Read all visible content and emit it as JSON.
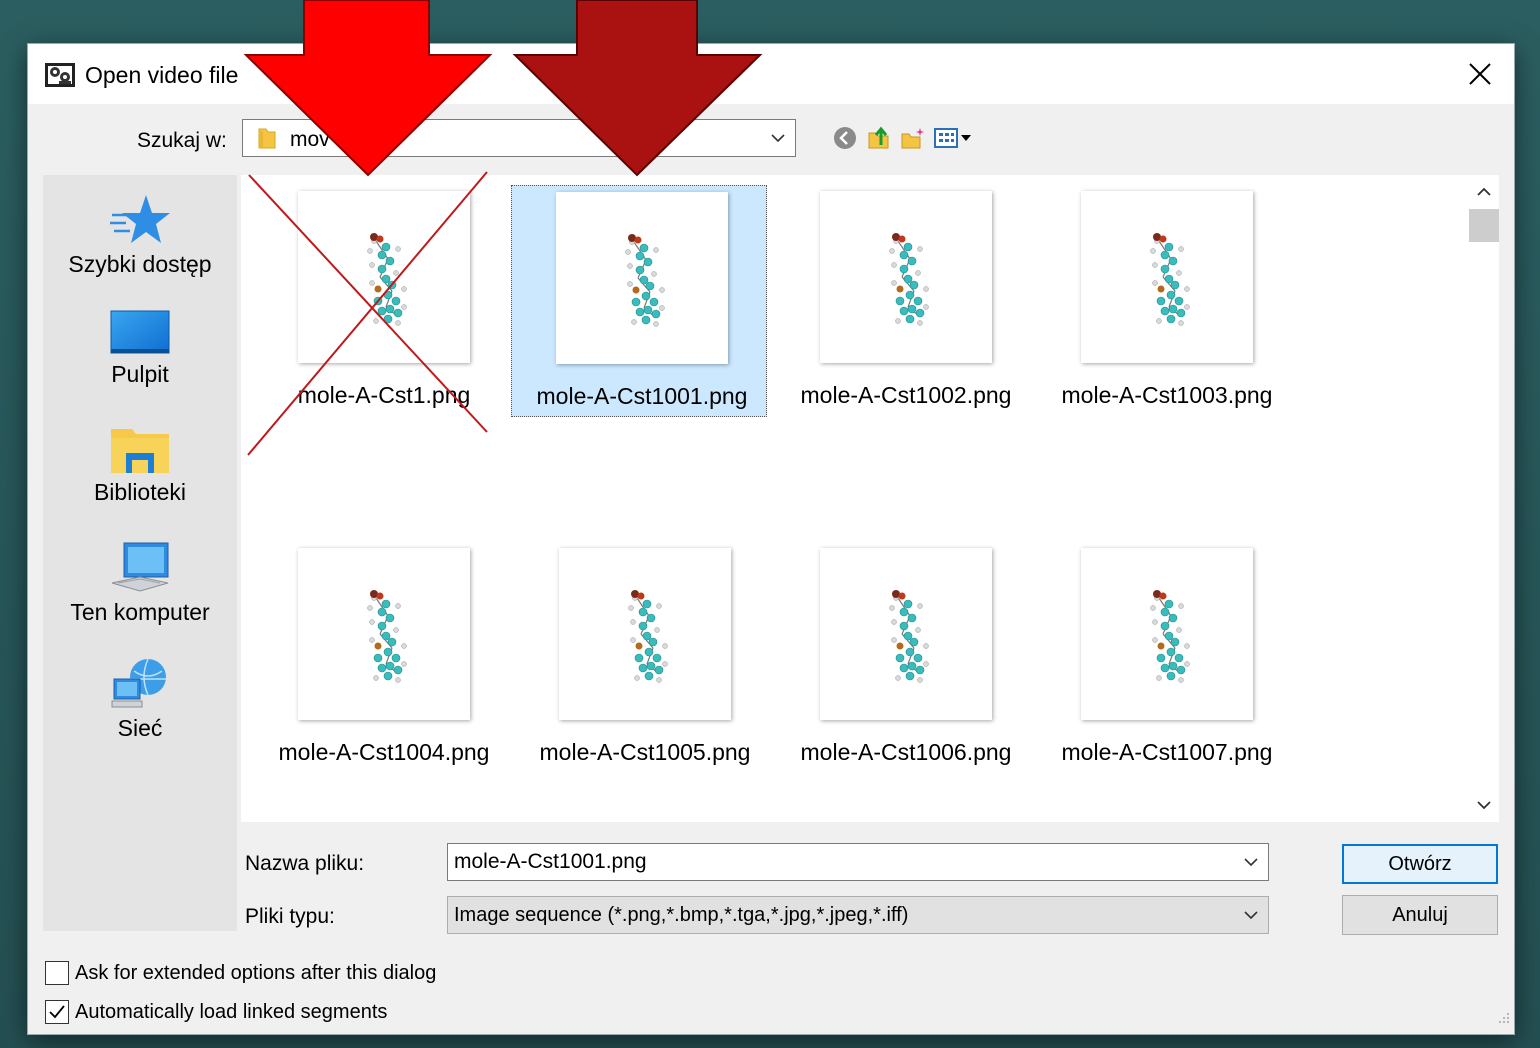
{
  "dialog": {
    "title": "Open video file",
    "look_in": {
      "label": "Szukaj w:",
      "value": "mov"
    },
    "places": [
      {
        "label": "Szybki dostęp",
        "icon": "star-icon"
      },
      {
        "label": "Pulpit",
        "icon": "desktop-icon"
      },
      {
        "label": "Biblioteki",
        "icon": "libraries-icon"
      },
      {
        "label": "Ten komputer",
        "icon": "computer-icon"
      },
      {
        "label": "Sieć",
        "icon": "network-icon"
      }
    ],
    "files": [
      {
        "name": "mole-A-Cst1.png",
        "selected": false,
        "crossed_out": true
      },
      {
        "name": "mole-A-Cst1001.png",
        "selected": true,
        "crossed_out": false
      },
      {
        "name": "mole-A-Cst1002.png",
        "selected": false,
        "crossed_out": false
      },
      {
        "name": "mole-A-Cst1003.png",
        "selected": false,
        "crossed_out": false
      },
      {
        "name": "mole-A-Cst1004.png",
        "selected": false,
        "crossed_out": false
      },
      {
        "name": "mole-A-Cst1005.png",
        "selected": false,
        "crossed_out": false
      },
      {
        "name": "mole-A-Cst1006.png",
        "selected": false,
        "crossed_out": false
      },
      {
        "name": "mole-A-Cst1007.png",
        "selected": false,
        "crossed_out": false
      }
    ],
    "filename": {
      "label": "Nazwa pliku:",
      "value": "mole-A-Cst1001.png"
    },
    "filetype": {
      "label": "Pliki typu:",
      "value": "Image sequence (*.png,*.bmp,*.tga,*.jpg,*.jpeg,*.iff)"
    },
    "buttons": {
      "open": "Otwórz",
      "cancel": "Anuluj"
    },
    "options": [
      {
        "label": "Ask for extended options after this dialog",
        "checked": false
      },
      {
        "label": "Automatically load linked segments",
        "checked": true
      }
    ]
  },
  "colors": {
    "selection_bg": "#cce8ff",
    "accent": "#0078d7",
    "arrow_bright": "#ff0000",
    "arrow_dark": "#aa1111",
    "cross_line": "#c0191b",
    "background": "#2b5e60"
  }
}
